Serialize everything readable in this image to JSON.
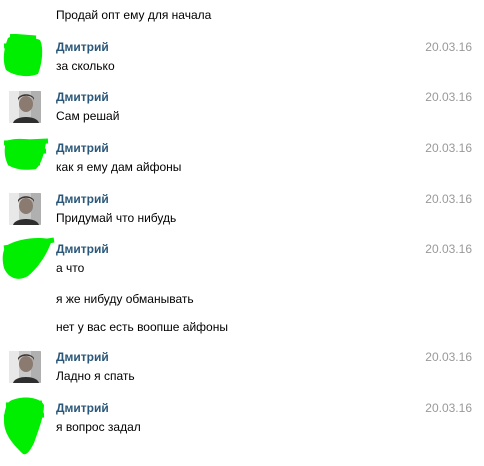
{
  "colors": {
    "author": "#2b587a",
    "date": "#999999",
    "scribble": "#00ee00"
  },
  "messages": [
    {
      "kind": "continuation",
      "text": "Продай опт ему для начала"
    },
    {
      "kind": "message",
      "author": "Дмитрий",
      "date": "20.03.16",
      "text": "за сколько",
      "avatar": "scribbled-avatar"
    },
    {
      "kind": "message",
      "author": "Дмитрий",
      "date": "20.03.16",
      "text": "Сам решай",
      "avatar": "photo-avatar"
    },
    {
      "kind": "message",
      "author": "Дмитрий",
      "date": "20.03.16",
      "text": "как я ему дам айфоны",
      "avatar": "scribbled-avatar"
    },
    {
      "kind": "message",
      "author": "Дмитрий",
      "date": "20.03.16",
      "text": "Придумай что нибудь",
      "avatar": "photo-avatar"
    },
    {
      "kind": "message",
      "author": "Дмитрий",
      "date": "20.03.16",
      "text": "а что",
      "avatar": "scribbled-avatar"
    },
    {
      "kind": "continuation",
      "text": "я же нибуду обманывать"
    },
    {
      "kind": "continuation",
      "text": "нет у вас есть воопше айфоны"
    },
    {
      "kind": "message",
      "author": "Дмитрий",
      "date": "20.03.16",
      "text": "Ладно я спать",
      "avatar": "photo-avatar"
    },
    {
      "kind": "message",
      "author": "Дмитрий",
      "date": "20.03.16",
      "text": "я вопрос задал",
      "avatar": "scribbled-avatar"
    }
  ]
}
